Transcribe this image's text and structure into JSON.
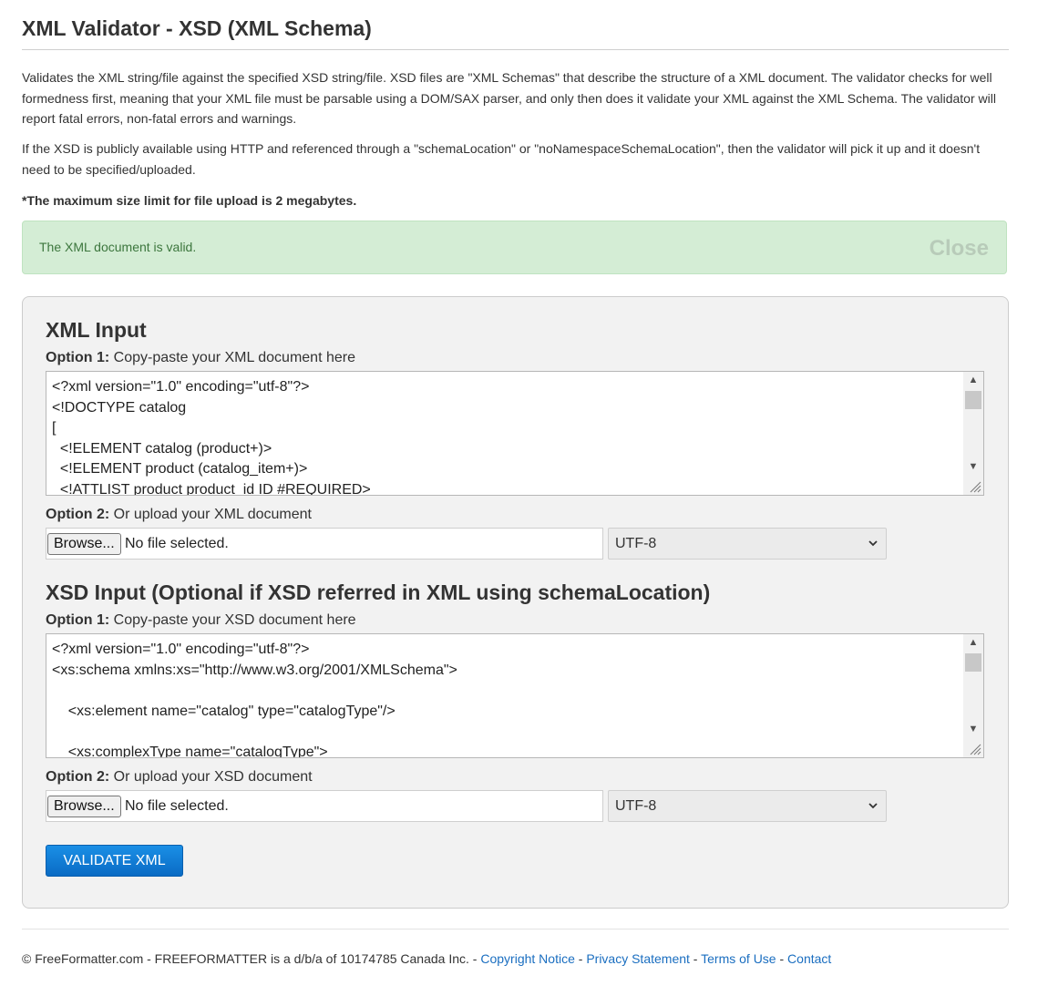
{
  "header": {
    "title": "XML Validator - XSD (XML Schema)"
  },
  "intro": {
    "paragraph1": "Validates the XML string/file against the specified XSD string/file. XSD files are \"XML Schemas\" that describe the structure of a XML document. The validator checks for well formedness first, meaning that your XML file must be parsable using a DOM/SAX parser, and only then does it validate your XML against the XML Schema. The validator will report fatal errors, non-fatal errors and warnings.",
    "paragraph2": "If the XSD is publicly available using HTTP and referenced through a \"schemaLocation\" or \"noNamespaceSchemaLocation\", then the validator will pick it up and it doesn't need to be specified/uploaded.",
    "size_note": "*The maximum size limit for file upload is 2 megabytes."
  },
  "alert": {
    "message": "The XML document is valid.",
    "close_label": "Close",
    "color": "#d4edd5"
  },
  "xml_input": {
    "title": "XML Input",
    "option1_prefix": "Option 1:",
    "option1_text": " Copy-paste your XML document here",
    "content": "<?xml version=\"1.0\" encoding=\"utf-8\"?>\n<!DOCTYPE catalog\n[\n  <!ELEMENT catalog (product+)>\n  <!ELEMENT product (catalog_item+)>\n  <!ATTLIST product product_id ID #REQUIRED>",
    "option2_prefix": "Option 2:",
    "option2_text": " Or upload your XML document",
    "browse_label": "Browse...",
    "file_status": "No file selected.",
    "encoding": "UTF-8"
  },
  "xsd_input": {
    "title": "XSD Input (Optional if XSD referred in XML using schemaLocation)",
    "option1_prefix": "Option 1:",
    "option1_text": " Copy-paste your XSD document here",
    "content": "<?xml version=\"1.0\" encoding=\"utf-8\"?>\n<xs:schema xmlns:xs=\"http://www.w3.org/2001/XMLSchema\">\n\n    <xs:element name=\"catalog\" type=\"catalogType\"/>\n\n    <xs:complexType name=\"catalogType\">",
    "option2_prefix": "Option 2:",
    "option2_text": " Or upload your XSD document",
    "browse_label": "Browse...",
    "file_status": "No file selected.",
    "encoding": "UTF-8"
  },
  "actions": {
    "validate_label": "VALIDATE XML",
    "accent": "#0a6bc4"
  },
  "footer": {
    "copyright": "© FreeFormatter.com - FREEFORMATTER is a d/b/a of 10174785 Canada Inc. - ",
    "links": [
      "Copyright Notice",
      "Privacy Statement",
      "Terms of Use",
      "Contact"
    ],
    "separator": " - ",
    "link_color": "#1a6ec0"
  }
}
